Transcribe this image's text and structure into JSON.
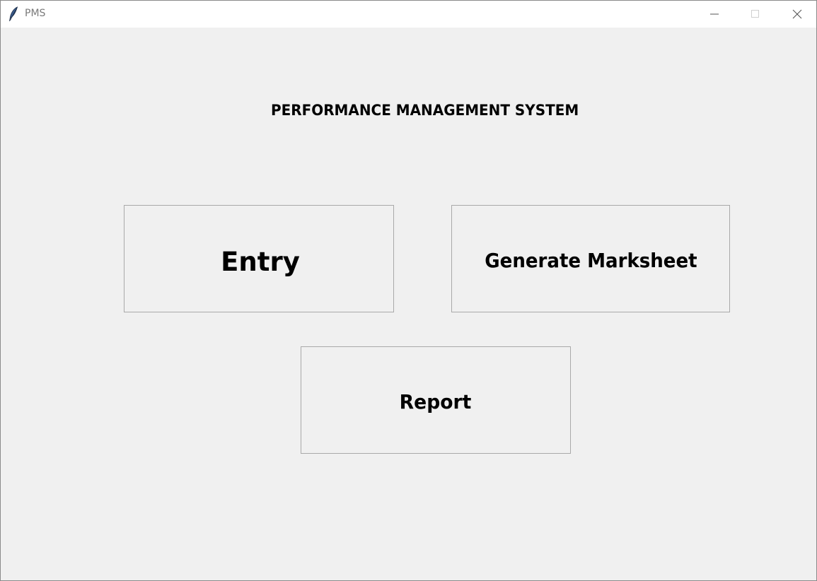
{
  "window": {
    "title": "PMS",
    "icon": "feather-icon",
    "controls": {
      "minimize_icon": "minimize-icon",
      "maximize_icon": "maximize-icon",
      "close_icon": "close-icon"
    }
  },
  "main": {
    "heading": "PERFORMANCE MANAGEMENT SYSTEM",
    "buttons": {
      "entry": "Entry",
      "generate_marksheet": "Generate Marksheet",
      "report": "Report"
    }
  },
  "colors": {
    "background": "#f0f0f0",
    "titlebar": "#ffffff",
    "button_border": "#a9a9a9",
    "text": "#000000"
  }
}
